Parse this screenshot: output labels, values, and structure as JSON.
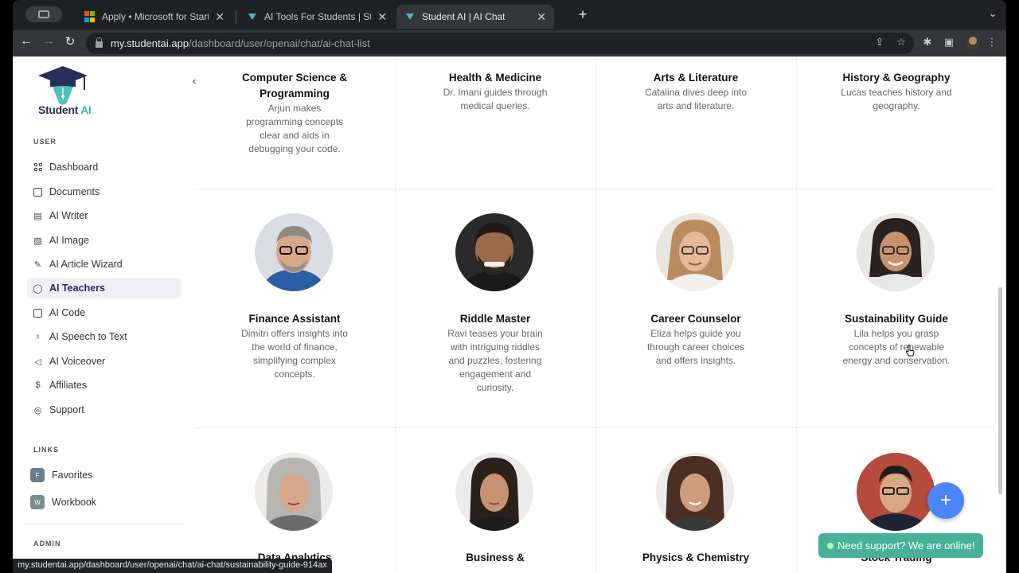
{
  "browser": {
    "tabs": [
      {
        "title": "Apply • Microsoft for Startups",
        "active": false
      },
      {
        "title": "AI Tools For Students | Studen",
        "active": false
      },
      {
        "title": "Student AI | AI Chat",
        "active": true
      }
    ],
    "url_host": "my.studentai.app",
    "url_path": "/dashboard/user/openai/chat/ai-chat-list",
    "status_url": "my.studentai.app/dashboard/user/openai/chat/ai-chat/sustainability-guide-914ax"
  },
  "brand": {
    "name_part1": "Student",
    "name_part2": " AI"
  },
  "sidebar": {
    "user_label": "USER",
    "items": [
      {
        "label": "Dashboard",
        "icon": "grid-icon"
      },
      {
        "label": "Documents",
        "icon": "archive-icon"
      },
      {
        "label": "AI Writer",
        "icon": "document-icon"
      },
      {
        "label": "AI Image",
        "icon": "image-icon"
      },
      {
        "label": "AI Article Wizard",
        "icon": "edit-document-icon"
      },
      {
        "label": "AI Teachers",
        "icon": "chat-bubble-icon",
        "active": true
      },
      {
        "label": "AI Code",
        "icon": "code-icon"
      },
      {
        "label": "AI Speech to Text",
        "icon": "microphone-icon"
      },
      {
        "label": "AI Voiceover",
        "icon": "speaker-icon"
      },
      {
        "label": "Affiliates",
        "icon": "dollar-icon"
      },
      {
        "label": "Support",
        "icon": "lifebuoy-icon"
      }
    ],
    "links_label": "LINKS",
    "links": [
      {
        "badge": "F",
        "label": "Favorites"
      },
      {
        "badge": "W",
        "label": "Workbook"
      }
    ],
    "admin_label": "ADMIN"
  },
  "cards": [
    {
      "name": "Computer Science & Programming",
      "desc": "Arjun makes programming concepts clear and aids in debugging your code."
    },
    {
      "name": "Health & Medicine",
      "desc": "Dr. Imani guides through medical queries."
    },
    {
      "name": "Arts & Literature",
      "desc": "Catalina dives deep into arts and literature."
    },
    {
      "name": "History & Geography",
      "desc": "Lucas teaches history and geography."
    },
    {
      "name": "Finance Assistant",
      "desc": "Dimitri offers insights into the world of finance, simplifying complex concepts."
    },
    {
      "name": "Riddle Master",
      "desc": "Ravi teases your brain with intriguing riddles and puzzles, fostering engagement and curiosity."
    },
    {
      "name": "Career Counselor",
      "desc": "Eliza helps guide you through career choices and offers insights."
    },
    {
      "name": "Sustainability Guide",
      "desc": "Lila helps you grasp concepts of renewable energy and conservation."
    },
    {
      "name": "Data Analytics",
      "desc": ""
    },
    {
      "name": "Business &",
      "desc": ""
    },
    {
      "name": "Physics & Chemistry",
      "desc": ""
    },
    {
      "name": "Stock Trading",
      "desc": ""
    }
  ],
  "support": {
    "label": "Need support? We are online!"
  },
  "fab": {
    "label": "+"
  },
  "colors": {
    "accent": "#4a86f7",
    "support": "#47b19a",
    "active_nav": "#1f2a6b",
    "brand_teal": "#3fb6a8"
  }
}
